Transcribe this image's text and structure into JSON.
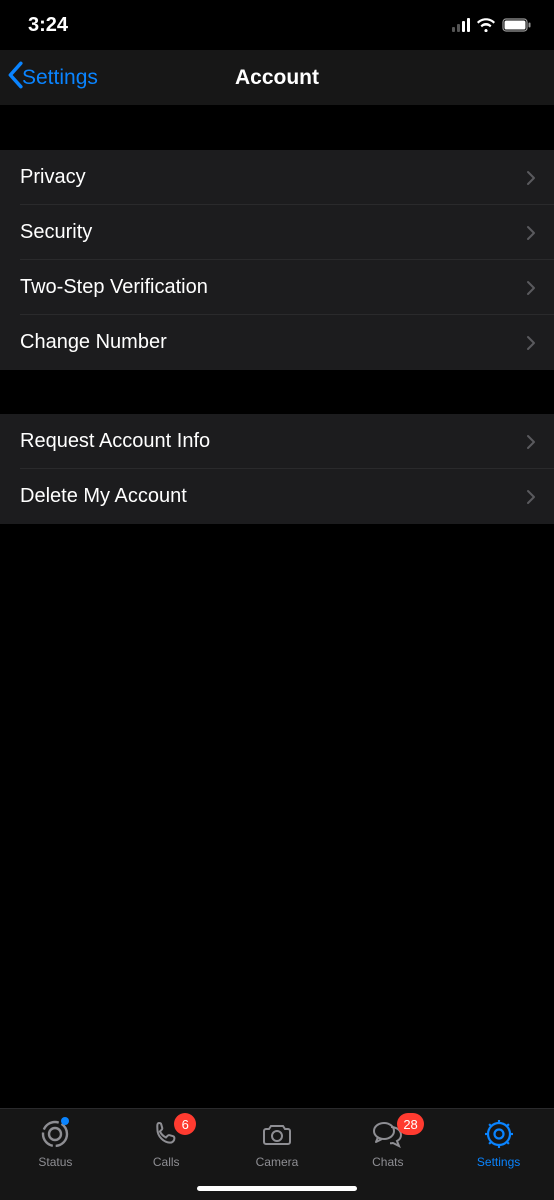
{
  "status": {
    "time": "3:24"
  },
  "nav": {
    "back_label": "Settings",
    "title": "Account"
  },
  "groups": [
    {
      "items": [
        {
          "label": "Privacy"
        },
        {
          "label": "Security"
        },
        {
          "label": "Two-Step Verification"
        },
        {
          "label": "Change Number"
        }
      ]
    },
    {
      "items": [
        {
          "label": "Request Account Info"
        },
        {
          "label": "Delete My Account"
        }
      ]
    }
  ],
  "tabs": {
    "status": {
      "label": "Status"
    },
    "calls": {
      "label": "Calls",
      "badge": "6"
    },
    "camera": {
      "label": "Camera"
    },
    "chats": {
      "label": "Chats",
      "badge": "28"
    },
    "settings": {
      "label": "Settings"
    }
  }
}
